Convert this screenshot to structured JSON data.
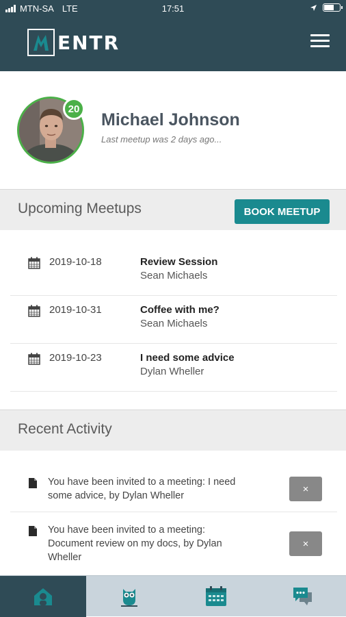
{
  "status_bar": {
    "carrier": "MTN-SA",
    "network": "LTE",
    "time": "17:51"
  },
  "header": {
    "logo_text": "ENTR",
    "logo_letter": "M"
  },
  "profile": {
    "name": "Michael Johnson",
    "subtitle": "Last meetup was 2 days ago...",
    "badge_count": "20"
  },
  "upcoming": {
    "title": "Upcoming Meetups",
    "book_button": "BOOK MEETUP",
    "items": [
      {
        "date": "2019-10-18",
        "title": "Review Session",
        "person": "Sean Michaels"
      },
      {
        "date": "2019-10-31",
        "title": "Coffee with me?",
        "person": "Sean Michaels"
      },
      {
        "date": "2019-10-23",
        "title": "I need some advice",
        "person": "Dylan  Wheller"
      }
    ]
  },
  "recent": {
    "title": "Recent Activity",
    "items": [
      {
        "text": "You have been invited to a meeting: I need some advice, by Dylan  Wheller",
        "dismiss": "×"
      },
      {
        "text": "You have been invited to a meeting: Document review on my docs, by Dylan  Wheller",
        "dismiss": "×"
      }
    ]
  },
  "tabs": [
    {
      "icon": "home-icon",
      "active": true
    },
    {
      "icon": "owl-icon",
      "active": false
    },
    {
      "icon": "calendar-icon",
      "active": false
    },
    {
      "icon": "chat-icon",
      "active": false
    }
  ],
  "colors": {
    "header": "#2f4b56",
    "accent_teal": "#1a8a8f",
    "badge_green": "#4bb048",
    "tab_bar": "#c9d4dc"
  }
}
